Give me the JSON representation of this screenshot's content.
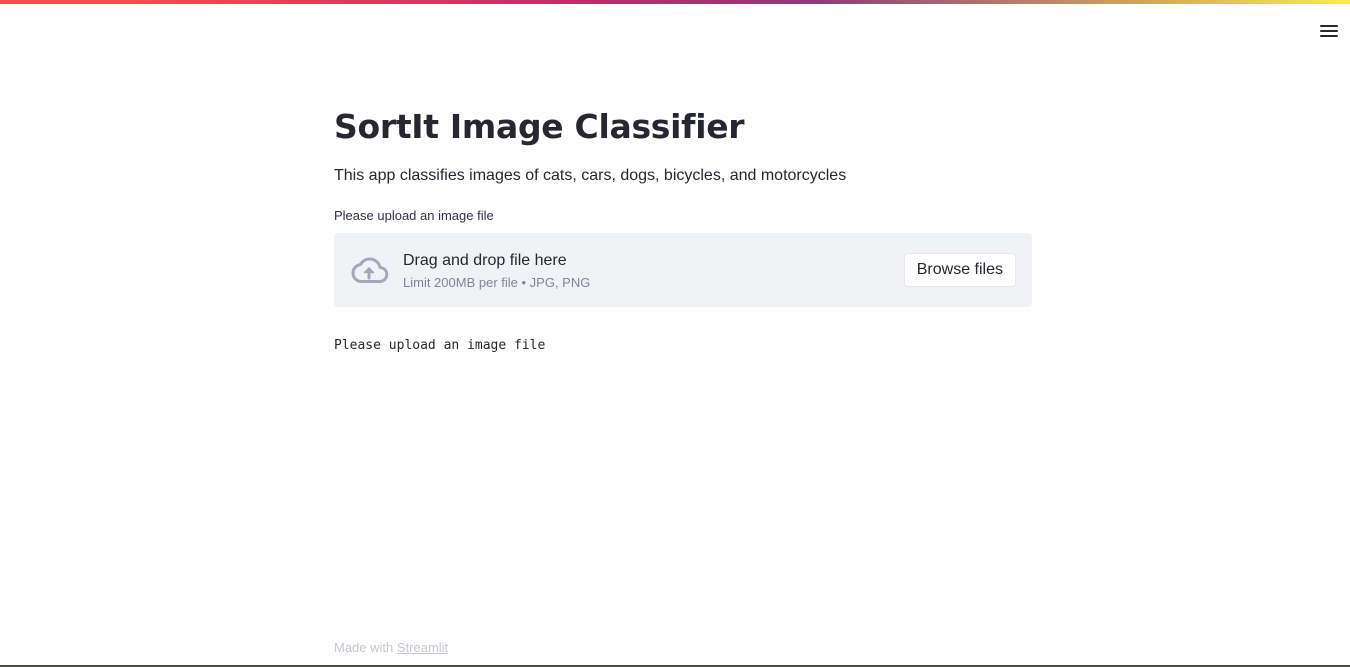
{
  "header": {
    "menu_icon": "hamburger-menu-icon",
    "accent_colors": [
      "#ff4b4b",
      "#c92a6a",
      "#fdeb4b"
    ]
  },
  "main": {
    "title": "SortIt Image Classifier",
    "subtitle": "This app classifies images of cats, cars, dogs, bicycles, and motorcycles",
    "uploader": {
      "label": "Please upload an image file",
      "drop_title": "Drag and drop file here",
      "drop_hint": "Limit 200MB per file • JPG, PNG",
      "browse_label": "Browse files",
      "icon": "cloud-upload-icon"
    },
    "status_text": "Please upload an image file"
  },
  "footer": {
    "prefix": "Made with",
    "link_label": "Streamlit"
  }
}
